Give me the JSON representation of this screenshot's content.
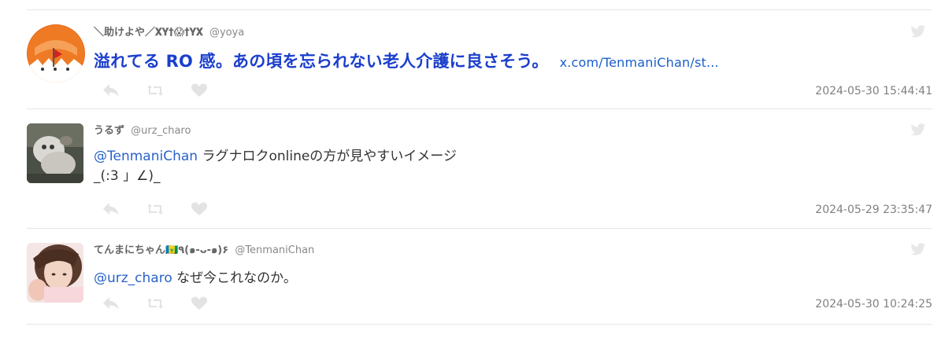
{
  "tweets": [
    {
      "display_name": "＼助けよや／𝐗𝐘†😱†𝐘𝐗",
      "handle": "@yoya",
      "text": "溢れてる RO 感。あの頃を忘られない老人介護に良さそう。",
      "link": "x.com/TenmaniChan/st...",
      "timestamp": "2024-05-30 15:44:41"
    },
    {
      "display_name": "うるず",
      "handle": "@urz_charo",
      "mention": "@TenmaniChan",
      "text_line1": " ラグナロクonlineの方が見やすいイメージ",
      "text_line2": "_(:3 」∠)_",
      "timestamp": "2024-05-29 23:35:47"
    },
    {
      "display_name": "てんまにちゃん🇻🇨٩(๑-ᴗ-๑)۶",
      "handle": "@TenmaniChan",
      "mention": "@urz_charo",
      "text": " なぜ今これなのか。",
      "timestamp": "2024-05-30 10:24:25"
    }
  ],
  "icons": {
    "reply": "reply-icon",
    "retweet": "retweet-icon",
    "like": "heart-icon",
    "brand": "twitter-bird-icon"
  },
  "colors": {
    "highlight_text": "#1b3fcc",
    "link": "#2a62c9",
    "action_icon": "#e3e3e3",
    "divider": "#e6e6e6"
  }
}
